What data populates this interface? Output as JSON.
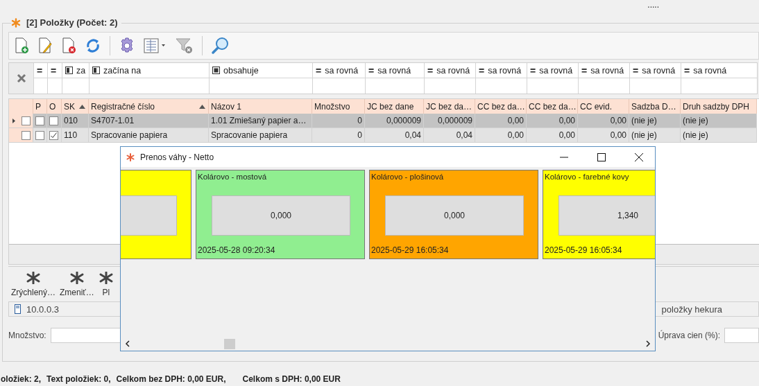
{
  "top_hint": ".....",
  "panel": {
    "title": "[2] Položky (Počet: 2)"
  },
  "filters": [
    {
      "kind": "equals",
      "symbol": "="
    },
    {
      "kind": "equals",
      "symbol": "="
    },
    {
      "kind": "starts",
      "label": "za"
    },
    {
      "kind": "starts",
      "label": "začína na"
    },
    {
      "kind": "contains",
      "label": "obsahuje"
    },
    {
      "kind": "equals",
      "symbol": "=",
      "label": "sa rovná"
    },
    {
      "kind": "equals",
      "symbol": "=",
      "label": "sa rovná"
    },
    {
      "kind": "equals",
      "symbol": "=",
      "label": "sa rovná"
    },
    {
      "kind": "equals",
      "symbol": "=",
      "label": "sa rovná"
    },
    {
      "kind": "equals",
      "symbol": "=",
      "label": "sa rovná"
    },
    {
      "kind": "equals",
      "symbol": "=",
      "label": "sa rovná"
    },
    {
      "kind": "equals",
      "symbol": "=",
      "label": "sa rovná"
    },
    {
      "kind": "equals",
      "symbol": "=",
      "label": "sa rovná"
    }
  ],
  "table": {
    "columns": [
      {
        "label": "P",
        "kind": "check",
        "sorted": false
      },
      {
        "label": "O",
        "kind": "check",
        "sorted": false
      },
      {
        "label": "SK",
        "kind": "text",
        "sorted": true
      },
      {
        "label": "Registračné číslo",
        "kind": "text",
        "sorted": true
      },
      {
        "label": "Názov 1",
        "kind": "text",
        "sorted": false
      },
      {
        "label": "Množstvo",
        "kind": "number",
        "sorted": false
      },
      {
        "label": "JC bez dane",
        "kind": "number",
        "sorted": false
      },
      {
        "label": "JC bez da…",
        "kind": "number",
        "sorted": false
      },
      {
        "label": "CC bez da…",
        "kind": "number",
        "sorted": false
      },
      {
        "label": "CC bez da…",
        "kind": "number",
        "sorted": false
      },
      {
        "label": "CC evid.",
        "kind": "number",
        "sorted": false
      },
      {
        "label": "Sadzba D…",
        "kind": "text",
        "sorted": false
      },
      {
        "label": "Druh sadzby DPH",
        "kind": "text",
        "sorted": false
      }
    ],
    "rows": [
      {
        "selected": true,
        "checked": false,
        "checks": [
          false,
          false
        ],
        "cells": [
          "",
          "",
          "010",
          "S4707-1.01",
          "1.01 Zmiešaný papier a…",
          "0",
          "0,000009",
          "0,000009",
          "0,00",
          "0,00",
          "0,00",
          "(nie je)",
          "(nie je)"
        ]
      },
      {
        "selected": false,
        "checked": false,
        "checks": [
          false,
          true
        ],
        "cells": [
          "",
          "",
          "110",
          "Spracovanie papiera",
          "Spracovanie papiera",
          "0",
          "0,04",
          "0,04",
          "0,00",
          "0,00",
          "0,00",
          "(nie je)",
          "(nie je)"
        ]
      }
    ]
  },
  "actions": [
    {
      "label": "Zrýchlený…"
    },
    {
      "label": "Zmeniť…"
    },
    {
      "label": "Pl"
    }
  ],
  "status": {
    "address": "10.0.0.3",
    "right": "položky hekura"
  },
  "form": {
    "quantity_label": "Množstvo:",
    "price_label": "Úprava cien (%):"
  },
  "summary": [
    "oložiek: 2,",
    "Text položiek: 0,",
    "Celkom bez DPH: 0,00 EUR,",
    "Celkom s DPH: 0,00 EUR"
  ],
  "dialog": {
    "title": "Prenos váhy - Netto",
    "cards": [
      {
        "color": "#ffff00"
      },
      {
        "name": "Kolárovo - mostová",
        "value": "0,000",
        "time": "2025-05-28 09:20:34",
        "color": "#90ee90"
      },
      {
        "name": "Kolárovo - plošinová",
        "value": "0,000",
        "time": "2025-05-29 16:05:34",
        "color": "#ffa500"
      },
      {
        "name": "Kolárovo - farebné kovy",
        "value": "1,340",
        "time": "2025-05-29 16:05:34",
        "color": "#ffff00"
      }
    ]
  }
}
